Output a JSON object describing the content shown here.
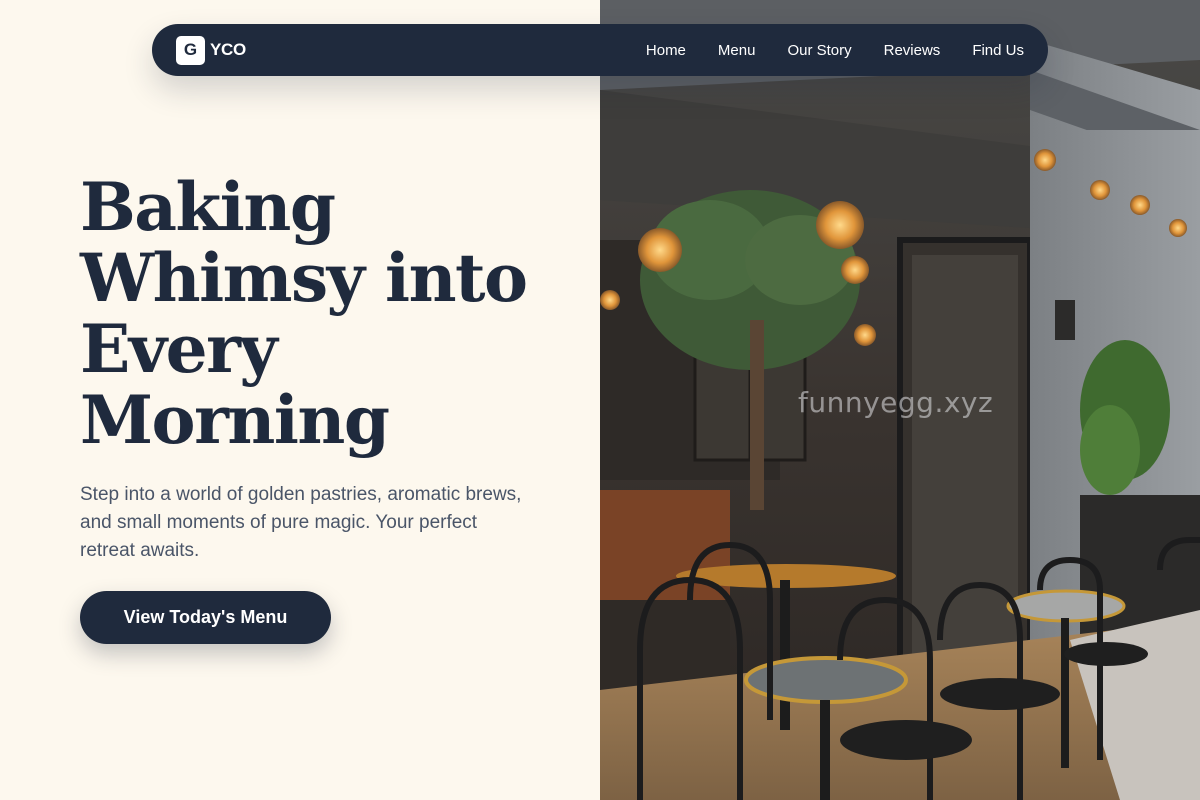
{
  "nav": {
    "logo_mark": "G",
    "logo_text": "YCO",
    "links": [
      "Home",
      "Menu",
      "Our Story",
      "Reviews",
      "Find Us"
    ]
  },
  "hero": {
    "title": "Baking Whimsy into Every Morning",
    "subtitle": "Step into a world of golden pastries, aromatic brews, and small moments of pure magic. Your perfect retreat awaits.",
    "cta_label": "View Today's Menu"
  },
  "image": {
    "watermark": "funnyegg.xyz"
  },
  "colors": {
    "background": "#fdf8ee",
    "navy": "#1f2a3d",
    "body_text": "#4a5568"
  }
}
